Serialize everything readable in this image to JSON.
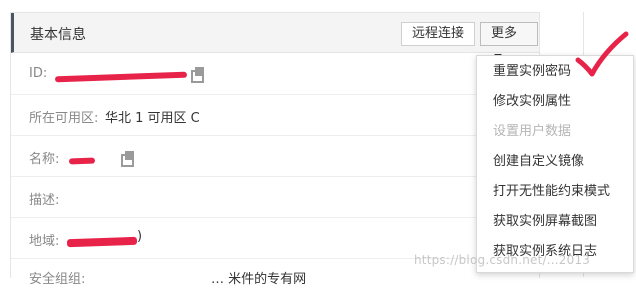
{
  "header": {
    "title": "基本信息",
    "remote_button": "远程连接",
    "more_button": "更多"
  },
  "fields": [
    {
      "label": "ID:",
      "value": ""
    },
    {
      "label": "所在可用区:",
      "value": "华北 1 可用区 C"
    },
    {
      "label": "名称:",
      "value": ""
    },
    {
      "label": "描述:",
      "value": ""
    },
    {
      "label": "地域:",
      "value": ")"
    },
    {
      "label": "安全组组:",
      "value": "… 米件的专有网"
    }
  ],
  "menu": {
    "items": [
      {
        "label": "重置实例密码",
        "disabled": false
      },
      {
        "label": "修改实例属性",
        "disabled": false
      },
      {
        "label": "设置用户数据",
        "disabled": true
      },
      {
        "label": "创建自定义镜像",
        "disabled": false
      },
      {
        "label": "打开无性能约束模式",
        "disabled": false
      },
      {
        "label": "获取实例屏幕截图",
        "disabled": false
      },
      {
        "label": "获取实例系统日志",
        "disabled": false
      }
    ]
  },
  "watermark": "https://blog.csdn.net/...2013",
  "colors": {
    "redaction": "#e8234a",
    "header_bg": "#f4f4f4",
    "accent_bar": "#4b5563"
  }
}
